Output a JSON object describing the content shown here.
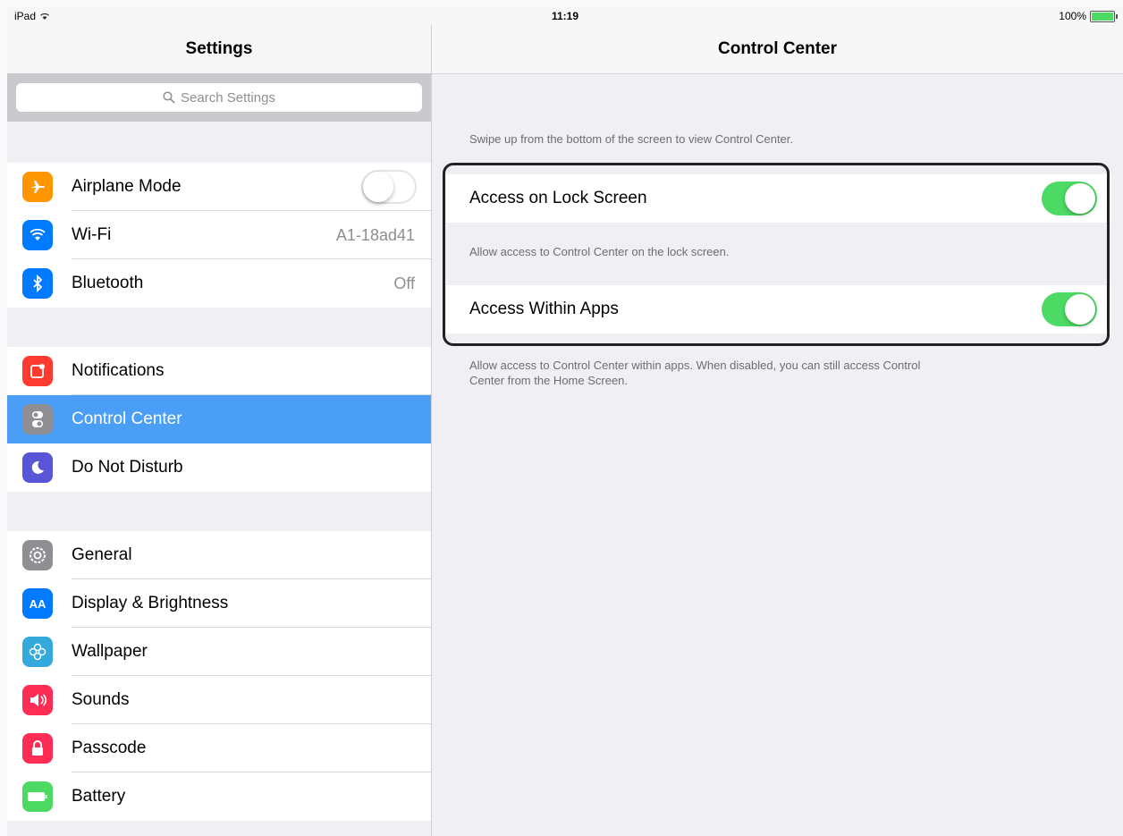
{
  "status": {
    "device": "iPad",
    "time": "11:19",
    "battery": "100%"
  },
  "left": {
    "title": "Settings",
    "search_placeholder": "Search Settings",
    "group1": [
      {
        "label": "Airplane Mode",
        "icon": "airplane-icon",
        "color": "#ff9500",
        "accessory": "toggle-off"
      },
      {
        "label": "Wi-Fi",
        "icon": "wifi-icon",
        "color": "#007aff",
        "value": "A1-18ad41"
      },
      {
        "label": "Bluetooth",
        "icon": "bluetooth-icon",
        "color": "#007aff",
        "value": "Off"
      }
    ],
    "group2": [
      {
        "label": "Notifications",
        "icon": "notifications-icon",
        "color": "#ff3b30"
      },
      {
        "label": "Control Center",
        "icon": "control-center-icon",
        "color": "#8e8e93",
        "selected": true
      },
      {
        "label": "Do Not Disturb",
        "icon": "moon-icon",
        "color": "#5856d6"
      }
    ],
    "group3": [
      {
        "label": "General",
        "icon": "gear-icon",
        "color": "#8e8e93"
      },
      {
        "label": "Display & Brightness",
        "icon": "display-icon",
        "color": "#007aff"
      },
      {
        "label": "Wallpaper",
        "icon": "wallpaper-icon",
        "color": "#34aadc"
      },
      {
        "label": "Sounds",
        "icon": "speaker-icon",
        "color": "#ff2d55"
      },
      {
        "label": "Passcode",
        "icon": "lock-icon",
        "color": "#ff2d55"
      },
      {
        "label": "Battery",
        "icon": "battery-icon",
        "color": "#4cd964"
      }
    ]
  },
  "right": {
    "title": "Control Center",
    "header": "Swipe up from the bottom of the screen to view Control Center.",
    "lock_screen_label": "Access on Lock Screen",
    "lock_screen_footer": "Allow access to Control Center on the lock screen.",
    "within_apps_label": "Access Within Apps",
    "within_apps_footer_1": "Allow access to Control Center within apps. When disabled, you can still access Control",
    "within_apps_footer_2": "Center from the Home Screen.",
    "lock_screen_enabled": true,
    "within_apps_enabled": true
  }
}
